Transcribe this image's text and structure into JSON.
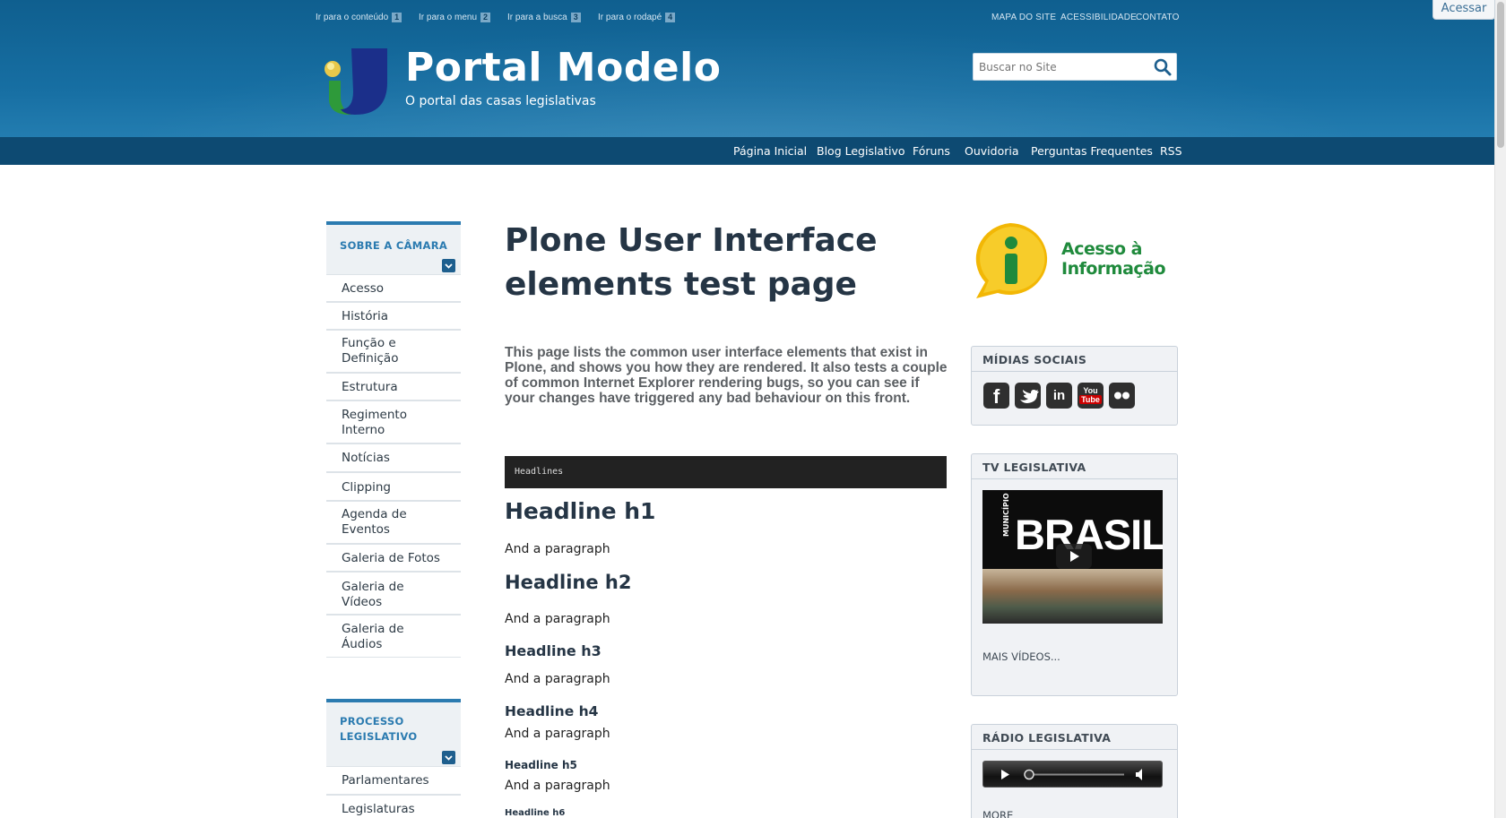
{
  "skip_links": [
    {
      "label": "Ir para o conteúdo",
      "key": "1"
    },
    {
      "label": "Ir para o menu",
      "key": "2"
    },
    {
      "label": "Ir para a busca",
      "key": "3"
    },
    {
      "label": "Ir para o rodapé",
      "key": "4"
    }
  ],
  "top_links": [
    "MAPA DO SITE",
    "ACESSIBILIDADE",
    "CONTATO"
  ],
  "login_label": "Acessar",
  "site": {
    "title": "Portal Modelo",
    "subtitle": "O portal das casas legislativas"
  },
  "search": {
    "placeholder": "Buscar no Site",
    "icon": "search-icon"
  },
  "main_nav": [
    "Página Inicial",
    "Blog Legislativo",
    "Fóruns",
    "Ouvidoria",
    "Perguntas Frequentes",
    "RSS"
  ],
  "sidebar": {
    "sections": [
      {
        "title": "SOBRE A CÂMARA",
        "items": [
          "Acesso",
          "História",
          "Função e Definição",
          "Estrutura",
          "Regimento Interno",
          "Notícias",
          "Clipping",
          "Agenda de Eventos",
          "Galeria de Fotos",
          "Galeria de Vídeos",
          "Galeria de Áudios"
        ]
      },
      {
        "title": "PROCESSO LEGISLATIVO",
        "items": [
          "Parlamentares",
          "Legislaturas"
        ]
      }
    ]
  },
  "main": {
    "title": "Plone User Interface elements test page",
    "description": "This page lists the common user interface elements that exist in Plone, and shows you how they are rendered. It also tests a couple of common Internet Explorer rendering bugs, so you can see if your changes have triggered any bad behaviour on this front.",
    "code_label": "Headlines",
    "headlines": [
      {
        "text": "Headline h1",
        "paragraph": "And a paragraph"
      },
      {
        "text": "Headline h2",
        "paragraph": "And a paragraph"
      },
      {
        "text": "Headline h3",
        "paragraph": "And a paragraph"
      },
      {
        "text": "Headline h4",
        "paragraph": "And a paragraph"
      },
      {
        "text": "Headline h5",
        "paragraph": "And a paragraph"
      },
      {
        "text": "Headline h6",
        "paragraph": ""
      }
    ]
  },
  "right": {
    "acesso_info": {
      "line1": "Acesso à",
      "line2": "Informação"
    },
    "social": {
      "title": "MÍDIAS SOCIAIS",
      "icons": [
        "facebook-icon",
        "twitter-icon",
        "linkedin-icon",
        "youtube-icon",
        "flickr-icon"
      ]
    },
    "tv": {
      "title": "TV LEGISLATIVA",
      "video_side_label": "MUNICÍPIO",
      "video_title": "BRASIL",
      "more": "MAIS VÍDEOS..."
    },
    "radio": {
      "title": "RÁDIO LEGISLATIVA",
      "more": "MORE"
    }
  },
  "colors": {
    "header": "#176fa3",
    "navbar": "#0d4a72",
    "accent": "#2b7bb0",
    "code_bg": "#222222"
  }
}
